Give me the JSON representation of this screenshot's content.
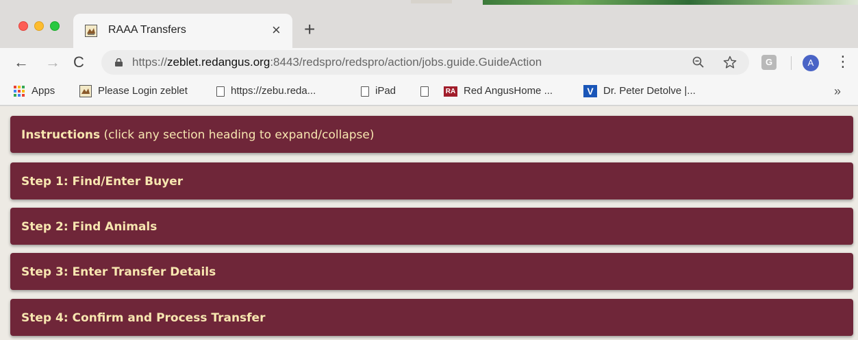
{
  "browser": {
    "tab": {
      "title": "RAAA Transfers",
      "close_glyph": "×"
    },
    "new_tab_glyph": "+",
    "nav": {
      "back_glyph": "←",
      "forward_glyph": "→",
      "reload_glyph": "C"
    },
    "url": {
      "scheme": "https://",
      "host": "zeblet.redangus.org",
      "rest": ":8443/redspro/redspro/action/jobs.guide.GuideAction"
    },
    "extension_label": "G",
    "avatar_initial": "A",
    "menu_glyph": "⋮",
    "bookmarks": [
      {
        "label": "Apps",
        "icon": "apps-grid-icon"
      },
      {
        "label": "Please Login zeblet",
        "icon": "site-favicon"
      },
      {
        "label": "https://zebu.reda...",
        "icon": "page-icon"
      },
      {
        "label": "iPad",
        "icon": "page-icon"
      },
      {
        "label": "",
        "icon": "page-icon"
      },
      {
        "label": "Red AngusHome ...",
        "icon": "ra-icon",
        "icon_text": "RA"
      },
      {
        "label": "Dr. Peter Detolve |...",
        "icon": "v-icon",
        "icon_text": "V"
      }
    ],
    "bookmarks_more_glyph": "»"
  },
  "sections": [
    {
      "title": "Instructions",
      "note": " (click any section heading to expand/collapse)"
    },
    {
      "title": "Step 1: Find/Enter Buyer"
    },
    {
      "title": "Step 2: Find Animals"
    },
    {
      "title": "Step 3: Enter Transfer Details"
    },
    {
      "title": "Step 4: Confirm and Process Transfer"
    }
  ],
  "colors": {
    "section_bg": "#6f2639",
    "section_text": "#f7e6b0",
    "page_bg": "#edeae4"
  }
}
